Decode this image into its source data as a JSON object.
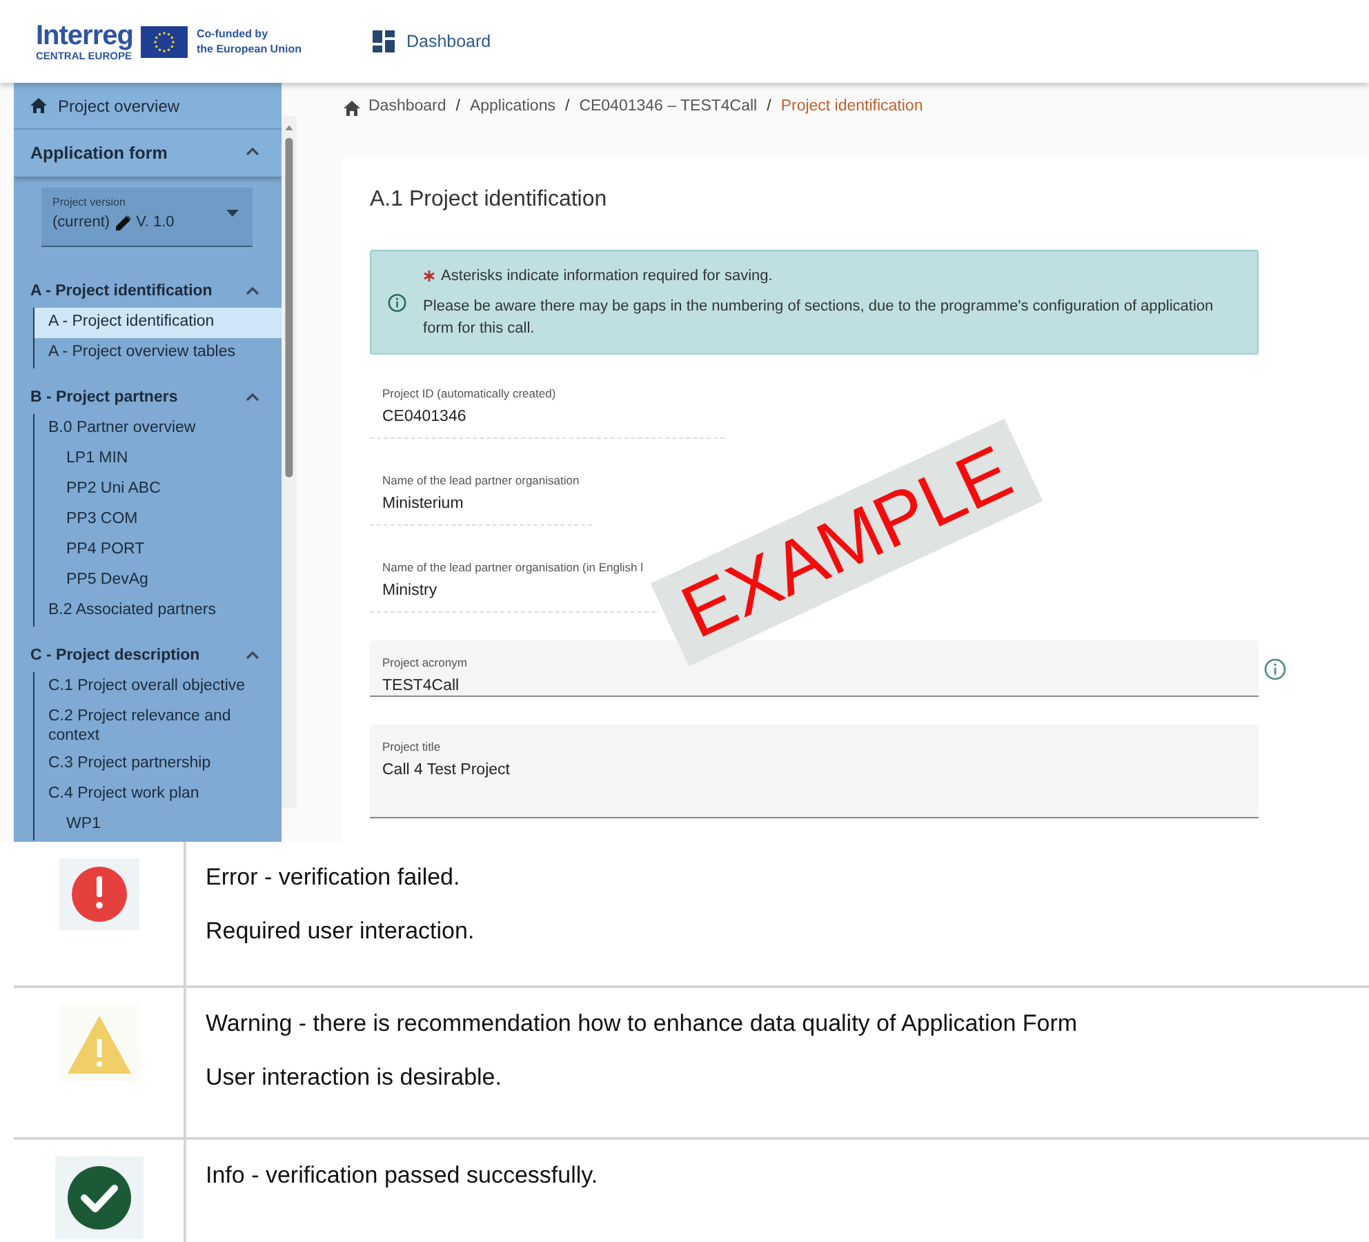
{
  "header": {
    "logo": {
      "brand": "Interreg",
      "region": "CENTRAL EUROPE",
      "cofunded": [
        "Co-funded by",
        "the European Union"
      ]
    },
    "nav": "Dashboard"
  },
  "sidebar": {
    "overview": "Project overview",
    "section": {
      "title": "Application form",
      "expanded": true
    },
    "version": {
      "label": "Project version",
      "value_prefix": "(current)",
      "value": "V. 1.0"
    },
    "groups": [
      {
        "title": "A - Project identification",
        "expanded": true,
        "items": [
          {
            "label": "A - Project identification",
            "selected": true
          },
          {
            "label": "A - Project overview tables",
            "selected": false
          }
        ]
      },
      {
        "title": "B - Project partners",
        "expanded": true,
        "items": [
          {
            "label": "B.0 Partner overview",
            "selected": false,
            "children": [
              {
                "label": "LP1 MIN",
                "selected": false
              },
              {
                "label": "PP2 Uni ABC",
                "selected": false
              },
              {
                "label": "PP3 COM",
                "selected": false
              },
              {
                "label": "PP4 PORT",
                "selected": false
              },
              {
                "label": "PP5 DevAg",
                "selected": false
              }
            ]
          },
          {
            "label": "B.2 Associated partners",
            "selected": false
          }
        ]
      },
      {
        "title": "C - Project description",
        "expanded": true,
        "items": [
          {
            "label": "C.1 Project overall objective",
            "selected": false
          },
          {
            "label": "C.2 Project relevance and context",
            "selected": false
          },
          {
            "label": "C.3 Project partnership",
            "selected": false
          },
          {
            "label": "C.4 Project work plan",
            "selected": false,
            "children": [
              {
                "label": "WP1",
                "selected": false
              }
            ]
          }
        ]
      }
    ]
  },
  "breadcrumb": {
    "separator": "/",
    "items": [
      "Dashboard",
      "Applications",
      "CE0401346 – TEST4Call",
      "Project identification"
    ]
  },
  "form": {
    "title": "A.1 Project identification",
    "notice": {
      "required": "Asterisks indicate information required for saving.",
      "text": "Please be aware there may be gaps in the numbering of sections, due to the programme's configuration of application form for this call."
    },
    "fields": [
      {
        "kind": "readonly",
        "label": "Project ID (automatically created)",
        "value": "CE0401346"
      },
      {
        "kind": "readonly",
        "label": "Name of the lead partner organisation",
        "value": "Ministerium"
      },
      {
        "kind": "readonly",
        "label": "Name of the lead partner organisation (in English l",
        "value": "Ministry"
      },
      {
        "kind": "input",
        "label": "Project acronym",
        "value": "TEST4Call",
        "info": true
      },
      {
        "kind": "textarea",
        "label": "Project title",
        "value": "Call 4 Test Project"
      }
    ]
  },
  "stamp": "EXAMPLE",
  "legend": [
    {
      "kind": "error",
      "lines": [
        "Error - verification failed.",
        "Required user interaction."
      ]
    },
    {
      "kind": "warning",
      "lines": [
        "Warning - there is recommendation how to enhance data quality of Application Form",
        "User interaction is desirable."
      ]
    },
    {
      "kind": "info",
      "lines": [
        "Info - verification passed successfully."
      ]
    }
  ]
}
